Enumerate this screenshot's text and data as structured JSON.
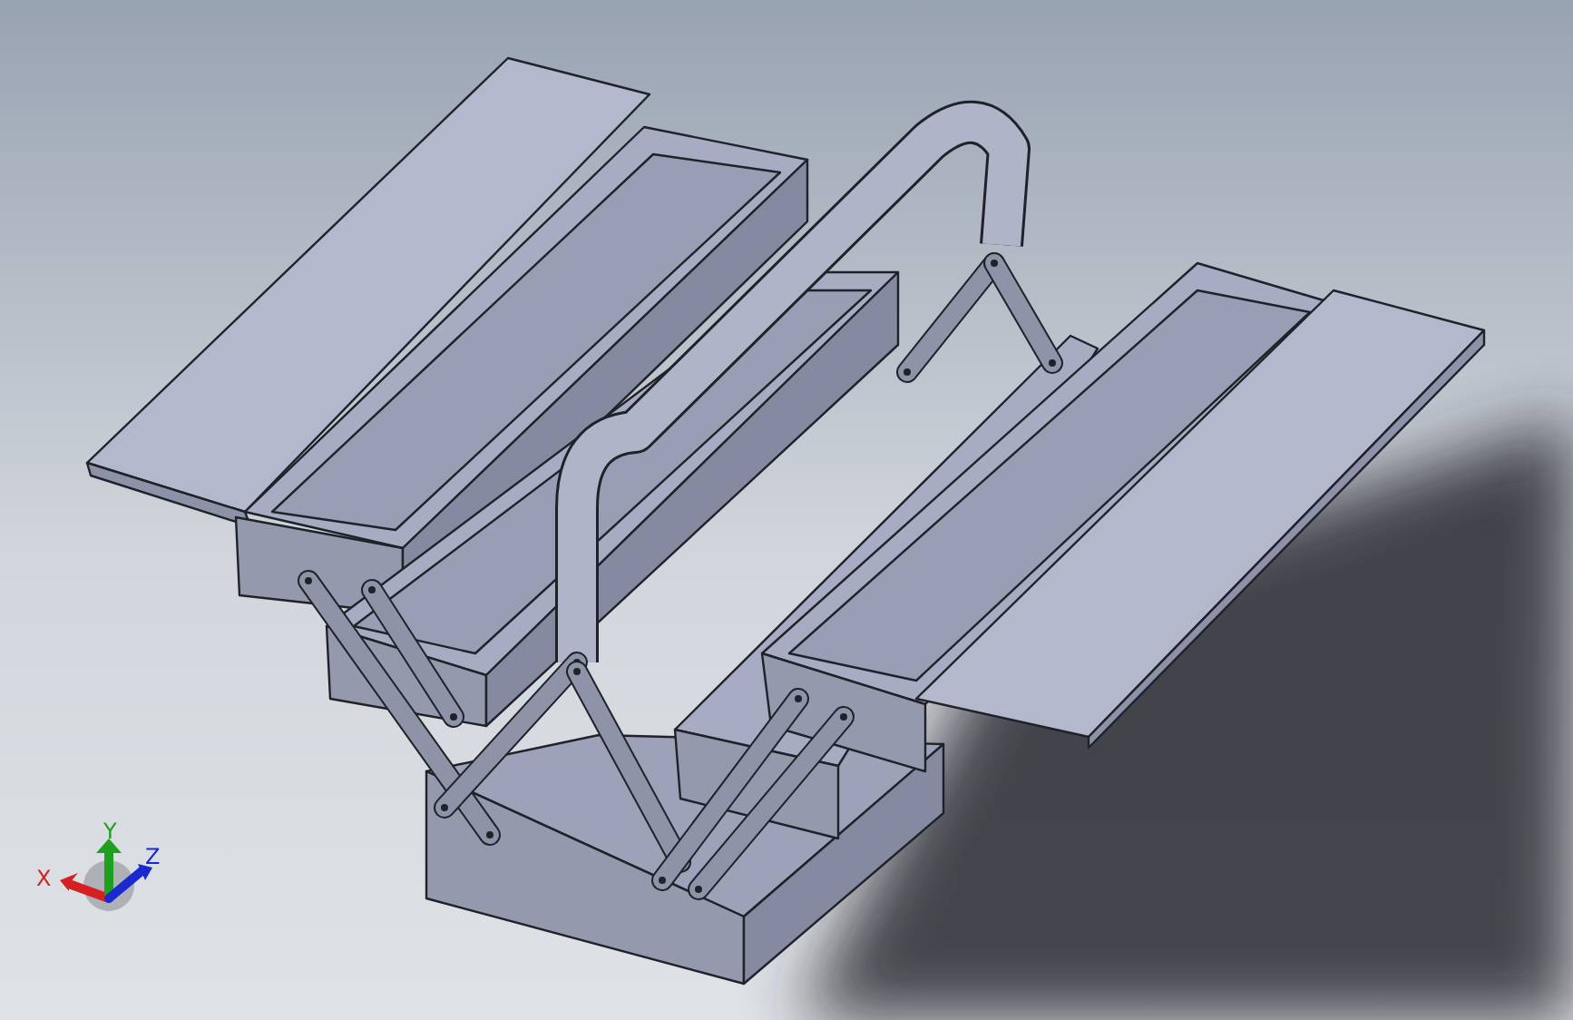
{
  "viewport": {
    "model": {
      "kind": "toolbox"
    },
    "triad": {
      "axes": [
        {
          "label": "X",
          "color": "#d42020"
        },
        {
          "label": "Y",
          "color": "#1ea01e"
        },
        {
          "label": "Z",
          "color": "#1a2ad0"
        }
      ]
    }
  }
}
